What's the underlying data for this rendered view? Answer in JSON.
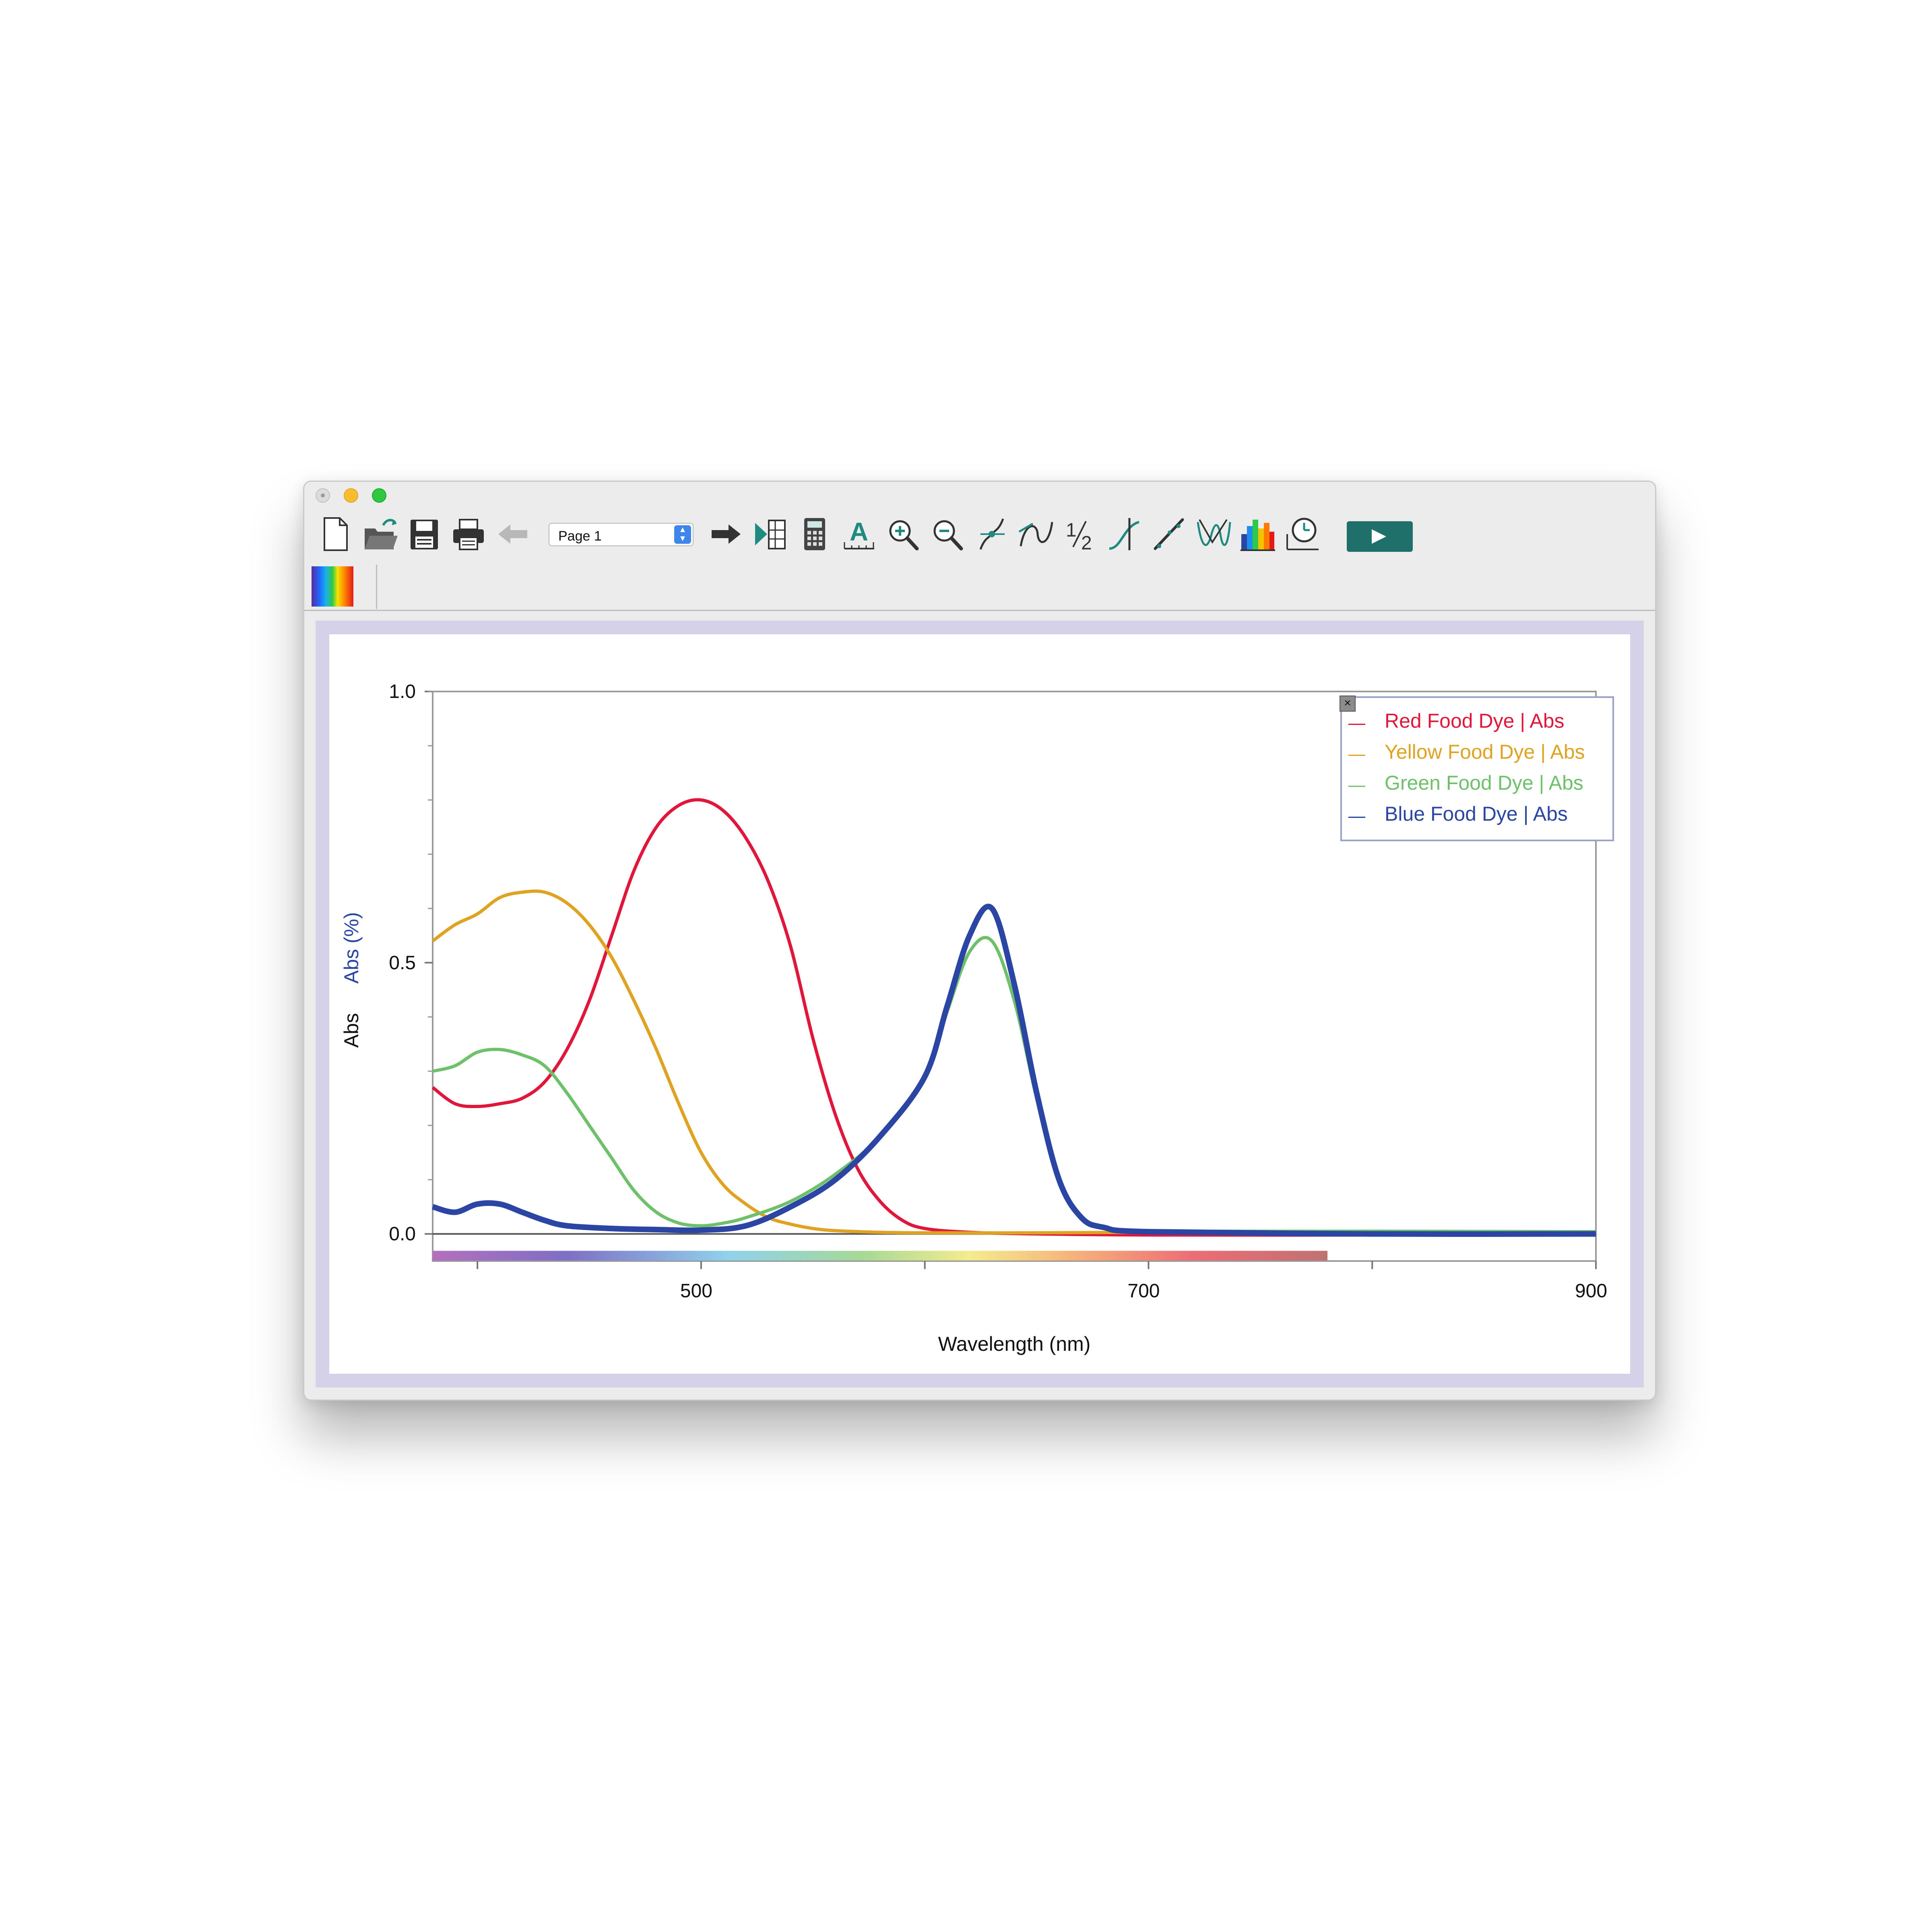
{
  "window": {
    "page_select": {
      "value": "Page 1"
    }
  },
  "toolbar": {
    "icons": [
      "new-file-icon",
      "open-folder-icon",
      "save-icon",
      "print-icon",
      "back-arrow-icon",
      "forward-arrow-icon",
      "toggle-panel-icon",
      "calculator-icon",
      "text-annotation-icon",
      "zoom-in-icon",
      "zoom-out-icon",
      "examine-icon",
      "tangent-icon",
      "integral-icon",
      "statistics-icon",
      "linear-fit-icon",
      "curve-fit-icon",
      "histogram-icon",
      "timer-icon",
      "play-icon"
    ]
  },
  "colors": {
    "red": "#e0173b",
    "yellow": "#dfa321",
    "green": "#6ec06a",
    "blue": "#2a45a3",
    "panel_border": "#d4d1e8"
  },
  "chart_data": {
    "type": "line",
    "xlabel": "Wavelength (nm)",
    "ylabel_left": "Abs",
    "ylabel_right": "Abs (%)",
    "xlim": [
      380,
      900
    ],
    "ylim": [
      -0.05,
      1.0
    ],
    "x_ticks": [
      {
        "value": 500,
        "label": "500"
      },
      {
        "value": 700,
        "label": "700"
      },
      {
        "value": 900,
        "label": "900"
      }
    ],
    "y_ticks": [
      {
        "value": 1.0,
        "label": "1.0"
      },
      {
        "value": 0.5,
        "label": "0.5"
      },
      {
        "value": 0.0,
        "label": "0.0"
      }
    ],
    "legend_position": "top-right",
    "series": [
      {
        "name": "Red Food Dye | Abs",
        "x": [
          380,
          390,
          400,
          410,
          420,
          430,
          440,
          450,
          460,
          470,
          480,
          490,
          500,
          510,
          520,
          530,
          540,
          550,
          560,
          570,
          580,
          590,
          600,
          620,
          650,
          700,
          800,
          900
        ],
        "y": [
          0.27,
          0.24,
          0.235,
          0.24,
          0.25,
          0.28,
          0.34,
          0.43,
          0.55,
          0.67,
          0.75,
          0.79,
          0.8,
          0.78,
          0.73,
          0.65,
          0.53,
          0.36,
          0.22,
          0.12,
          0.06,
          0.025,
          0.01,
          0.003,
          0.0,
          -0.002,
          -0.002,
          0.0
        ]
      },
      {
        "name": "Yellow Food Dye | Abs",
        "x": [
          380,
          390,
          400,
          410,
          420,
          430,
          440,
          450,
          460,
          470,
          480,
          490,
          500,
          510,
          520,
          530,
          540,
          550,
          560,
          580,
          600,
          650,
          700,
          800,
          900
        ],
        "y": [
          0.54,
          0.57,
          0.59,
          0.62,
          0.63,
          0.63,
          0.61,
          0.57,
          0.51,
          0.43,
          0.34,
          0.24,
          0.15,
          0.09,
          0.055,
          0.03,
          0.018,
          0.01,
          0.006,
          0.003,
          0.002,
          0.002,
          0.003,
          0.003,
          0.004
        ]
      },
      {
        "name": "Green Food Dye | Abs",
        "x": [
          380,
          390,
          400,
          410,
          420,
          430,
          440,
          450,
          460,
          470,
          480,
          490,
          500,
          510,
          520,
          540,
          560,
          580,
          600,
          610,
          620,
          630,
          640,
          650,
          660,
          670,
          680,
          700,
          800,
          900
        ],
        "y": [
          0.3,
          0.31,
          0.335,
          0.34,
          0.33,
          0.31,
          0.26,
          0.2,
          0.14,
          0.08,
          0.04,
          0.02,
          0.015,
          0.02,
          0.03,
          0.06,
          0.11,
          0.18,
          0.29,
          0.41,
          0.52,
          0.54,
          0.43,
          0.25,
          0.1,
          0.03,
          0.01,
          0.005,
          0.005,
          0.004
        ]
      },
      {
        "name": "Blue Food Dye | Abs",
        "x": [
          380,
          390,
          400,
          410,
          420,
          430,
          440,
          460,
          480,
          500,
          520,
          540,
          560,
          580,
          600,
          610,
          620,
          630,
          640,
          650,
          660,
          670,
          680,
          700,
          800,
          900
        ],
        "y": [
          0.05,
          0.04,
          0.055,
          0.055,
          0.04,
          0.025,
          0.015,
          0.01,
          0.008,
          0.007,
          0.015,
          0.05,
          0.1,
          0.18,
          0.29,
          0.42,
          0.55,
          0.6,
          0.46,
          0.26,
          0.1,
          0.03,
          0.012,
          0.004,
          0.0,
          0.0
        ]
      }
    ]
  }
}
